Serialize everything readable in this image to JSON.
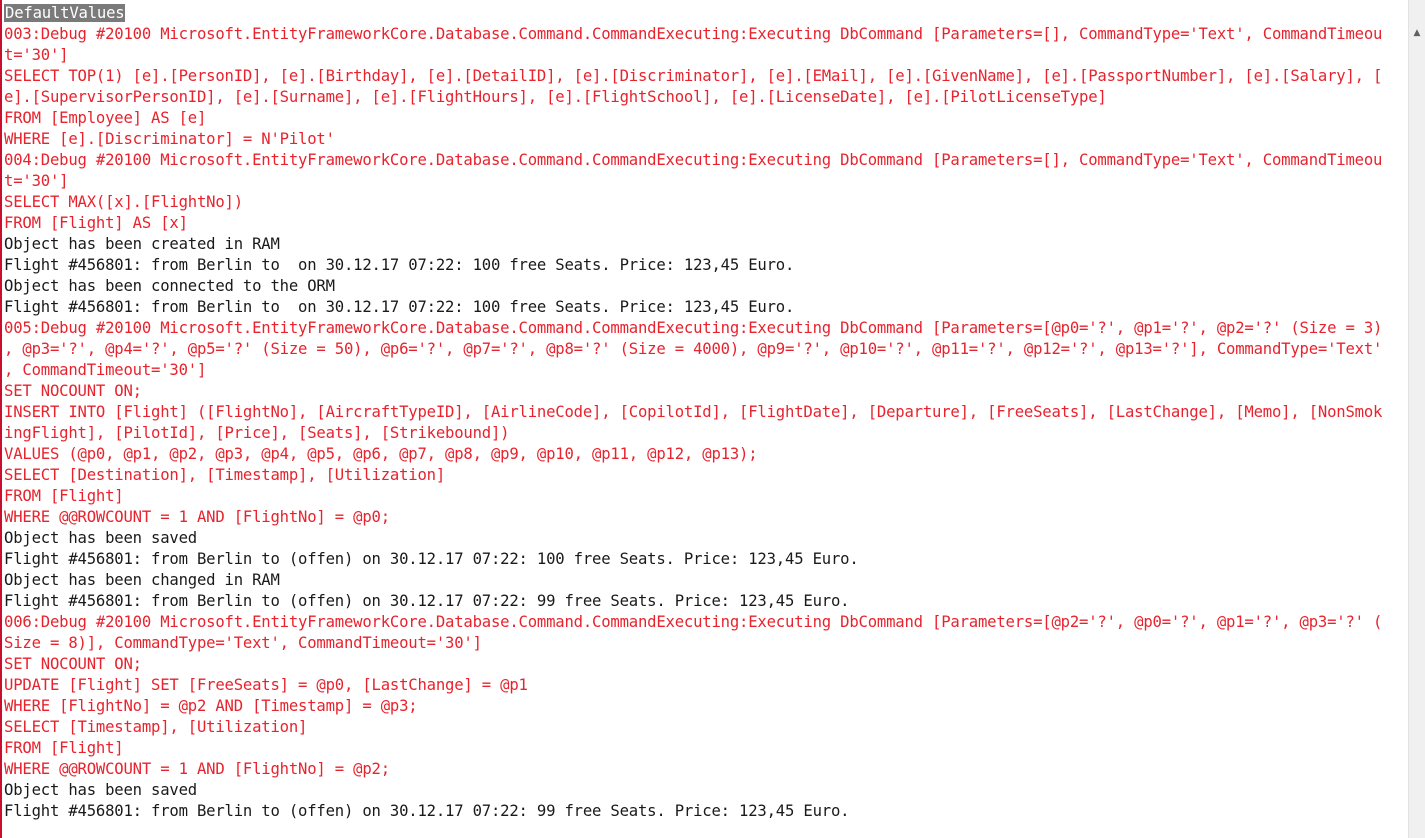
{
  "console": {
    "lines": [
      {
        "text": "DefaultValues",
        "color": "black",
        "selected": true
      },
      {
        "text": "003:Debug #20100 Microsoft.EntityFrameworkCore.Database.Command.CommandExecuting:Executing DbCommand [Parameters=[], CommandType='Text', CommandTimeou",
        "color": "red"
      },
      {
        "text": "t='30']",
        "color": "red"
      },
      {
        "text": "SELECT TOP(1) [e].[PersonID], [e].[Birthday], [e].[DetailID], [e].[Discriminator], [e].[EMail], [e].[GivenName], [e].[PassportNumber], [e].[Salary], [",
        "color": "red"
      },
      {
        "text": "e].[SupervisorPersonID], [e].[Surname], [e].[FlightHours], [e].[FlightSchool], [e].[LicenseDate], [e].[PilotLicenseType]",
        "color": "red"
      },
      {
        "text": "FROM [Employee] AS [e]",
        "color": "red"
      },
      {
        "text": "WHERE [e].[Discriminator] = N'Pilot'",
        "color": "red"
      },
      {
        "text": "004:Debug #20100 Microsoft.EntityFrameworkCore.Database.Command.CommandExecuting:Executing DbCommand [Parameters=[], CommandType='Text', CommandTimeou",
        "color": "red"
      },
      {
        "text": "t='30']",
        "color": "red"
      },
      {
        "text": "SELECT MAX([x].[FlightNo])",
        "color": "red"
      },
      {
        "text": "FROM [Flight] AS [x]",
        "color": "red"
      },
      {
        "text": "Object has been created in RAM",
        "color": "black"
      },
      {
        "text": "Flight #456801: from Berlin to  on 30.12.17 07:22: 100 free Seats. Price: 123,45 Euro.",
        "color": "black"
      },
      {
        "text": "Object has been connected to the ORM",
        "color": "black"
      },
      {
        "text": "Flight #456801: from Berlin to  on 30.12.17 07:22: 100 free Seats. Price: 123,45 Euro.",
        "color": "black"
      },
      {
        "text": "005:Debug #20100 Microsoft.EntityFrameworkCore.Database.Command.CommandExecuting:Executing DbCommand [Parameters=[@p0='?', @p1='?', @p2='?' (Size = 3)",
        "color": "red"
      },
      {
        "text": ", @p3='?', @p4='?', @p5='?' (Size = 50), @p6='?', @p7='?', @p8='?' (Size = 4000), @p9='?', @p10='?', @p11='?', @p12='?', @p13='?'], CommandType='Text'",
        "color": "red"
      },
      {
        "text": ", CommandTimeout='30']",
        "color": "red"
      },
      {
        "text": "SET NOCOUNT ON;",
        "color": "red"
      },
      {
        "text": "INSERT INTO [Flight] ([FlightNo], [AircraftTypeID], [AirlineCode], [CopilotId], [FlightDate], [Departure], [FreeSeats], [LastChange], [Memo], [NonSmok",
        "color": "red"
      },
      {
        "text": "ingFlight], [PilotId], [Price], [Seats], [Strikebound])",
        "color": "red"
      },
      {
        "text": "VALUES (@p0, @p1, @p2, @p3, @p4, @p5, @p6, @p7, @p8, @p9, @p10, @p11, @p12, @p13);",
        "color": "red"
      },
      {
        "text": "SELECT [Destination], [Timestamp], [Utilization]",
        "color": "red"
      },
      {
        "text": "FROM [Flight]",
        "color": "red"
      },
      {
        "text": "WHERE @@ROWCOUNT = 1 AND [FlightNo] = @p0;",
        "color": "red"
      },
      {
        "text": "Object has been saved",
        "color": "black"
      },
      {
        "text": "Flight #456801: from Berlin to (offen) on 30.12.17 07:22: 100 free Seats. Price: 123,45 Euro.",
        "color": "black"
      },
      {
        "text": "Object has been changed in RAM",
        "color": "black"
      },
      {
        "text": "Flight #456801: from Berlin to (offen) on 30.12.17 07:22: 99 free Seats. Price: 123,45 Euro.",
        "color": "black"
      },
      {
        "text": "006:Debug #20100 Microsoft.EntityFrameworkCore.Database.Command.CommandExecuting:Executing DbCommand [Parameters=[@p2='?', @p0='?', @p1='?', @p3='?' (",
        "color": "red"
      },
      {
        "text": "Size = 8)], CommandType='Text', CommandTimeout='30']",
        "color": "red"
      },
      {
        "text": "SET NOCOUNT ON;",
        "color": "red"
      },
      {
        "text": "UPDATE [Flight] SET [FreeSeats] = @p0, [LastChange] = @p1",
        "color": "red"
      },
      {
        "text": "WHERE [FlightNo] = @p2 AND [Timestamp] = @p3;",
        "color": "red"
      },
      {
        "text": "SELECT [Timestamp], [Utilization]",
        "color": "red"
      },
      {
        "text": "FROM [Flight]",
        "color": "red"
      },
      {
        "text": "WHERE @@ROWCOUNT = 1 AND [FlightNo] = @p2;",
        "color": "red"
      },
      {
        "text": "Object has been saved",
        "color": "black"
      },
      {
        "text": "Flight #456801: from Berlin to (offen) on 30.12.17 07:22: 99 free Seats. Price: 123,45 Euro.",
        "color": "black"
      }
    ]
  },
  "scrollbar": {
    "up_icon": "chevron-up-icon"
  },
  "colors": {
    "sql_text": "#e8232e",
    "normal_text": "#1a1a1a",
    "selection": "#7a7a7a"
  }
}
